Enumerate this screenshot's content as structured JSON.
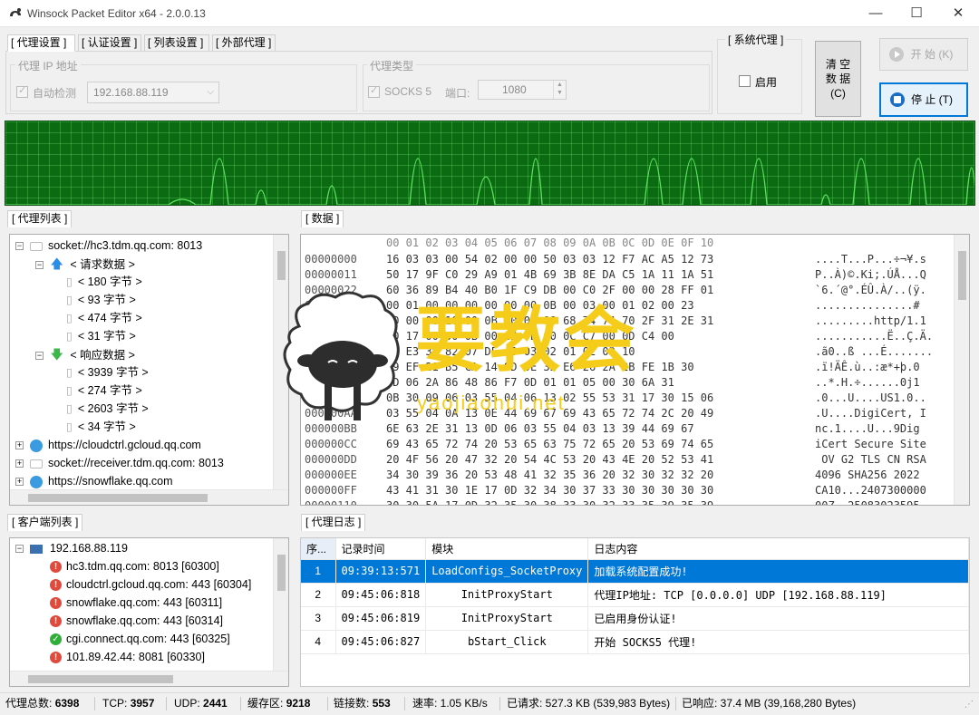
{
  "window": {
    "title": "Winsock Packet Editor x64 - 2.0.0.13",
    "minimize_glyph": "—",
    "maximize_glyph": "☐",
    "close_glyph": "✕"
  },
  "top_tabs": [
    "[ 代理设置 ]",
    "[ 认证设置 ]",
    "[ 列表设置 ]",
    "[ 外部代理 ]"
  ],
  "proxy_settings": {
    "proxy_ip_group": "代理 IP 地址",
    "auto_detect_label": "自动检测",
    "ip_value": "192.168.88.119",
    "proxy_type_group": "代理类型",
    "socks5_label": "SOCKS 5",
    "port_label": "端口:",
    "port_value": "1080"
  },
  "system_proxy": {
    "title": "[ 系统代理 ]",
    "enable_label": "启用"
  },
  "buttons": {
    "clear_line1": "清 空",
    "clear_line2": "数 据",
    "clear_line3": "(C)",
    "start_label": "开 始 (K)",
    "stop_label": "停 止 (T)"
  },
  "proxy_list": {
    "title": "[ 代理列表 ]",
    "items": [
      {
        "label": "socket://hc3.tdm.qq.com: 8013"
      },
      {
        "label": "< 请求数据 >"
      },
      {
        "label": "< 180 字节 >"
      },
      {
        "label": "< 93 字节 >"
      },
      {
        "label": "< 474 字节 >"
      },
      {
        "label": "< 31 字节 >"
      },
      {
        "label": "< 响应数据 >"
      },
      {
        "label": "< 3939 字节 >"
      },
      {
        "label": "< 274 字节 >"
      },
      {
        "label": "< 2603 字节 >"
      },
      {
        "label": "< 34 字节 >"
      },
      {
        "label": "https://cloudctrl.gcloud.qq.com"
      },
      {
        "label": "socket://receiver.tdm.qq.com: 8013"
      },
      {
        "label": "https://snowflake.qq.com"
      }
    ]
  },
  "data_pane": {
    "title": "[ 数据 ]",
    "header_offsets": "00 01 02 03 04 05 06 07 08 09 0A 0B 0C 0D 0E 0F 10",
    "rows": [
      {
        "off": "00000000",
        "hex": "16 03 03 00 54 02 00 00 50 03 03 12 F7 AC A5 12 73",
        "ascii": "....T...P...÷¬¥.s"
      },
      {
        "off": "00000011",
        "hex": "50 17 9F C0 29 A9 01 4B 69 3B 8E DA C5 1A 11 1A 51",
        "ascii": "P..À)©.Ki;.ÚÅ...Q"
      },
      {
        "off": "00000022",
        "hex": "60 36 89 B4 40 B0 1F C9 DB 00 C0 2F 00 00 28 FF 01",
        "ascii": "`6.´@°.ÉÛ.À/..(ÿ."
      },
      {
        "off": "00000033",
        "hex": "00 01 00 00 00 00 00 00 0B 00 03 00 01 02 00 23",
        "ascii": "...............#"
      },
      {
        "off": "00000044",
        "hex": "00 00 00 10 00 0B 00 09 08 68 74 74 70 2F 31 2E 31",
        "ascii": ".........http/1.1"
      },
      {
        "off": "00000055",
        "hex": "00 17 00 00 0B 00 CB 0B 00 0C C7 00 0D C4 00",
        "ascii": "...........Ë..Ç.Ä."
      },
      {
        "off": "00000066",
        "hex": "07 E3 30 82 07 DF A0 03 02 01 02 02 10",
        "ascii": ".ã0..ß ...É......."
      },
      {
        "off": "00000077",
        "hex": "09 EF 21 B5 CA 14 9D 0E 32 E6 26 2A 2B FE 1B 30",
        "ascii": ".ï!ÄÊ.ù..:æ*+þ.0"
      },
      {
        "off": "00000088",
        "hex": "0D 06 2A 86 48 86 F7 0D 01 01 05 00 30 6A 31",
        "ascii": "..*.H.÷......0j1"
      },
      {
        "off": "00000099",
        "hex": "0B 30 09 06 03 55 04 06 13 02 55 53 31 17 30 15 06",
        "ascii": ".0...U....US1.0.."
      },
      {
        "off": "000000AA",
        "hex": "03 55 04 0A 13 0E 44 69 67 69 43 65 72 74 2C 20 49",
        "ascii": ".U....DigiCert, I"
      },
      {
        "off": "000000BB",
        "hex": "6E 63 2E 31 13 0D 06 03 55 04 03 13 39 44 69 67",
        "ascii": "nc.1....U...9Dig"
      },
      {
        "off": "000000CC",
        "hex": "69 43 65 72 74 20 53 65 63 75 72 65 20 53 69 74 65",
        "ascii": "iCert Secure Site"
      },
      {
        "off": "000000DD",
        "hex": "20 4F 56 20 47 32 20 54 4C 53 20 43 4E 20 52 53 41",
        "ascii": " OV G2 TLS CN RSA"
      },
      {
        "off": "000000EE",
        "hex": "34 30 39 36 20 53 48 41 32 35 36 20 32 30 32 32 20",
        "ascii": "4096 SHA256 2022 "
      },
      {
        "off": "000000FF",
        "hex": "43 41 31 30 1E 17 0D 32 34 30 37 33 30 30 30 30 30",
        "ascii": "CA10...2407300000"
      },
      {
        "off": "00000110",
        "hex": "30 30 5A 17 0D 32 35 30 38 33 30 32 33 35 39 35 39",
        "ascii": "00Z..25083023595"
      }
    ]
  },
  "client_list": {
    "title": "[ 客户端列表 ]",
    "items": [
      {
        "label": "192.168.88.119"
      },
      {
        "label": "hc3.tdm.qq.com: 8013 [60300]"
      },
      {
        "label": "cloudctrl.gcloud.qq.com: 443 [60304]"
      },
      {
        "label": "snowflake.qq.com: 443 [60311]"
      },
      {
        "label": "snowflake.qq.com: 443 [60314]"
      },
      {
        "label": "cgi.connect.qq.com: 443 [60325]"
      },
      {
        "label": "101.89.42.44: 8081 [60330]"
      }
    ]
  },
  "proxy_log": {
    "title": "[ 代理日志 ]",
    "columns": [
      "序...",
      "记录时间",
      "模块",
      "日志内容"
    ],
    "rows": [
      {
        "no": "1",
        "time": "09:39:13:571",
        "module": "LoadConfigs_SocketProxy",
        "content": "加载系统配置成功!"
      },
      {
        "no": "2",
        "time": "09:45:06:818",
        "module": "InitProxyStart",
        "content": "代理IP地址: TCP [0.0.0.0] UDP [192.168.88.119]"
      },
      {
        "no": "3",
        "time": "09:45:06:819",
        "module": "InitProxyStart",
        "content": "已启用身份认证!"
      },
      {
        "no": "4",
        "time": "09:45:06:827",
        "module": "bStart_Click",
        "content": "开始 SOCKS5 代理!"
      }
    ]
  },
  "statusbar": {
    "total_label": "代理总数:",
    "total": "6398",
    "tcp_label": "TCP:",
    "tcp": "3957",
    "udp_label": "UDP:",
    "udp": "2441",
    "buffer_label": "缓存区:",
    "buffer": "9218",
    "links_label": "链接数:",
    "links": "553",
    "speed": "速率: 1.05 KB/s",
    "requested": "已请求: 527.3 KB (539,983 Bytes)",
    "responded": "已响应: 37.4 MB (39,168,280 Bytes)"
  },
  "watermark": {
    "text": "要教会",
    "url": "yaojiaohui.net"
  },
  "colors": {
    "graph_bg": "#0b6b13",
    "graph_line": "#5fe35f",
    "selection": "#0078d7",
    "error_icon": "#e04a3c",
    "ok_icon": "#2fae3a",
    "watermark_yellow": "#f5cc1a"
  }
}
